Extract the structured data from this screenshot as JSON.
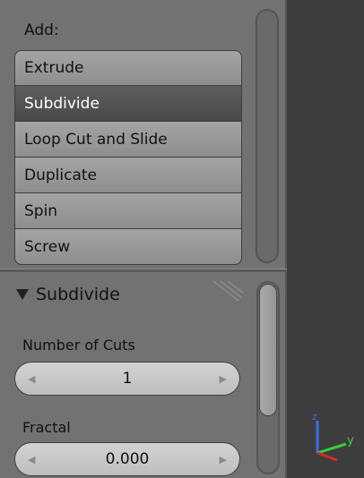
{
  "add_panel": {
    "label": "Add:",
    "buttons": [
      {
        "label": "Extrude",
        "active": false
      },
      {
        "label": "Subdivide",
        "active": true
      },
      {
        "label": "Loop Cut and Slide",
        "active": false
      },
      {
        "label": "Duplicate",
        "active": false
      },
      {
        "label": "Spin",
        "active": false
      },
      {
        "label": "Screw",
        "active": false
      }
    ]
  },
  "subdivide_panel": {
    "title": "Subdivide",
    "fields": [
      {
        "label": "Number of Cuts",
        "value": "1"
      },
      {
        "label": "Fractal",
        "value": "0.000"
      }
    ]
  },
  "icons": {
    "collapse": "triangle-down-icon",
    "grip": "drag-grip-icon",
    "decrement": "arrow-left-icon",
    "increment": "arrow-right-icon",
    "axis": "axis-gizmo-icon"
  },
  "colors": {
    "panel_bg": "#727272",
    "viewport_bg": "#3d3d3d",
    "active_button": "#555555",
    "axis_x": "#d22b2b",
    "axis_y": "#3ccd3c",
    "axis_z": "#3a6fe0"
  },
  "axis_gizmo": {
    "y_label": "y",
    "z_label": "z"
  }
}
